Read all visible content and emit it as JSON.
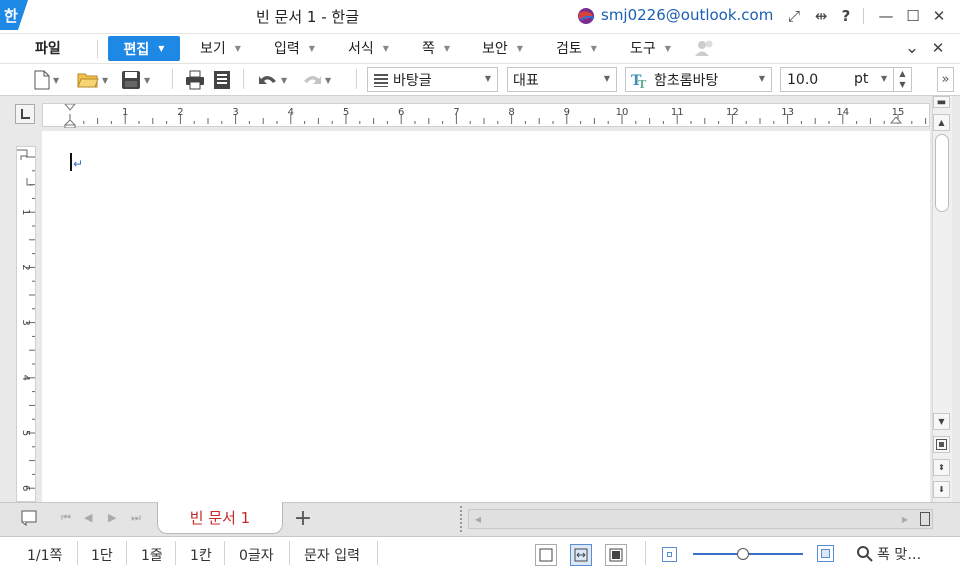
{
  "app": {
    "logo_char": "한",
    "title": "빈 문서 1 - 한글"
  },
  "account": {
    "email": "smj0226@outlook.com"
  },
  "window_controls": {
    "fullscreen": "⤢",
    "split": "⇹",
    "help": "?",
    "minimize": "—",
    "maximize": "☐",
    "close": "✕"
  },
  "menu": {
    "file": "파일",
    "items": [
      {
        "label": "편집",
        "active": true
      },
      {
        "label": "보기"
      },
      {
        "label": "입력"
      },
      {
        "label": "서식"
      },
      {
        "label": "쪽"
      },
      {
        "label": "보안"
      },
      {
        "label": "검토"
      },
      {
        "label": "도구"
      }
    ],
    "ribbon_toggle": "⌄",
    "doc_close": "✕"
  },
  "toolbar": {
    "style_name": "바탕글",
    "lang": "대표",
    "font_name": "함초롬바탕",
    "font_size": "10.0",
    "font_unit": "pt",
    "expand": "»"
  },
  "ruler": {
    "h_labels": [
      "1",
      "2",
      "3",
      "4",
      "5",
      "6",
      "7",
      "8",
      "9",
      "10",
      "11",
      "12",
      "13",
      "14",
      "15"
    ],
    "v_labels": [
      "1",
      "2",
      "3",
      "4",
      "5",
      "6"
    ]
  },
  "editor": {
    "paragraph_mark": "↵"
  },
  "tabs": {
    "active_tab": "빈 문서 1",
    "add": "+"
  },
  "status": {
    "page": "1/1쪽",
    "section": "1단",
    "line": "1줄",
    "column": "1칸",
    "chars": "0글자",
    "mode": "문자 입력",
    "zoom_label": "폭 맞…",
    "zoom_level": 0.45
  },
  "colors": {
    "accent": "#1e88e5",
    "tab_text": "#c42b2b",
    "email": "#1a5fb4"
  }
}
